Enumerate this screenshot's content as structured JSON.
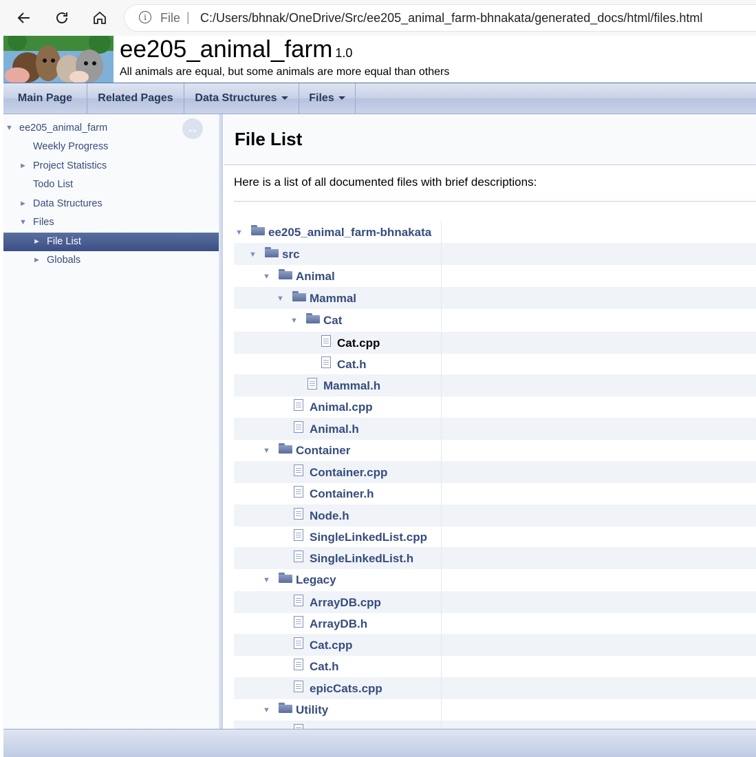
{
  "browser": {
    "scheme_label": "File",
    "separator": "|",
    "url": "C:/Users/bhnak/OneDrive/Src/ee205_animal_farm-bhnakata/generated_docs/html/files.html"
  },
  "project": {
    "name": "ee205_animal_farm",
    "number": "1.0",
    "brief": "All animals are equal, but some animals are more equal than others"
  },
  "menu": [
    "Main Page",
    "Related Pages",
    "Data Structures",
    "Files"
  ],
  "sidenav": {
    "items": [
      {
        "label": "ee205_animal_farm",
        "arrow": "▼",
        "level": 0
      },
      {
        "label": "Weekly Progress",
        "arrow": "",
        "level": 1
      },
      {
        "label": "Project Statistics",
        "arrow": "►",
        "level": 1
      },
      {
        "label": "Todo List",
        "arrow": "",
        "level": 1
      },
      {
        "label": "Data Structures",
        "arrow": "►",
        "level": 1
      },
      {
        "label": "Files",
        "arrow": "▼",
        "level": 1
      },
      {
        "label": "File List",
        "arrow": "►",
        "level": 2,
        "selected": true
      },
      {
        "label": "Globals",
        "arrow": "►",
        "level": 2
      }
    ]
  },
  "content": {
    "title": "File List",
    "intro": "Here is a list of all documented files with brief descriptions:",
    "tree": [
      {
        "name": "ee205_animal_farm-bhnakata",
        "type": "folder",
        "depth": 0
      },
      {
        "name": "src",
        "type": "folder",
        "depth": 1
      },
      {
        "name": "Animal",
        "type": "folder",
        "depth": 2
      },
      {
        "name": "Mammal",
        "type": "folder",
        "depth": 3
      },
      {
        "name": "Cat",
        "type": "folder",
        "depth": 4
      },
      {
        "name": "Cat.cpp",
        "type": "file",
        "depth": 5,
        "visited": true
      },
      {
        "name": "Cat.h",
        "type": "file",
        "depth": 5
      },
      {
        "name": "Mammal.h",
        "type": "file",
        "depth": 4
      },
      {
        "name": "Animal.cpp",
        "type": "file",
        "depth": 3
      },
      {
        "name": "Animal.h",
        "type": "file",
        "depth": 3
      },
      {
        "name": "Container",
        "type": "folder",
        "depth": 2
      },
      {
        "name": "Container.cpp",
        "type": "file",
        "depth": 3
      },
      {
        "name": "Container.h",
        "type": "file",
        "depth": 3
      },
      {
        "name": "Node.h",
        "type": "file",
        "depth": 3
      },
      {
        "name": "SingleLinkedList.cpp",
        "type": "file",
        "depth": 3
      },
      {
        "name": "SingleLinkedList.h",
        "type": "file",
        "depth": 3
      },
      {
        "name": "Legacy",
        "type": "folder",
        "depth": 2
      },
      {
        "name": "ArrayDB.cpp",
        "type": "file",
        "depth": 3
      },
      {
        "name": "ArrayDB.h",
        "type": "file",
        "depth": 3
      },
      {
        "name": "Cat.cpp",
        "type": "file",
        "depth": 3
      },
      {
        "name": "Cat.h",
        "type": "file",
        "depth": 3
      },
      {
        "name": "epicCats.cpp",
        "type": "file",
        "depth": 3
      },
      {
        "name": "Utility",
        "type": "folder",
        "depth": 2
      },
      {
        "name": "",
        "type": "file",
        "depth": 3
      }
    ]
  }
}
